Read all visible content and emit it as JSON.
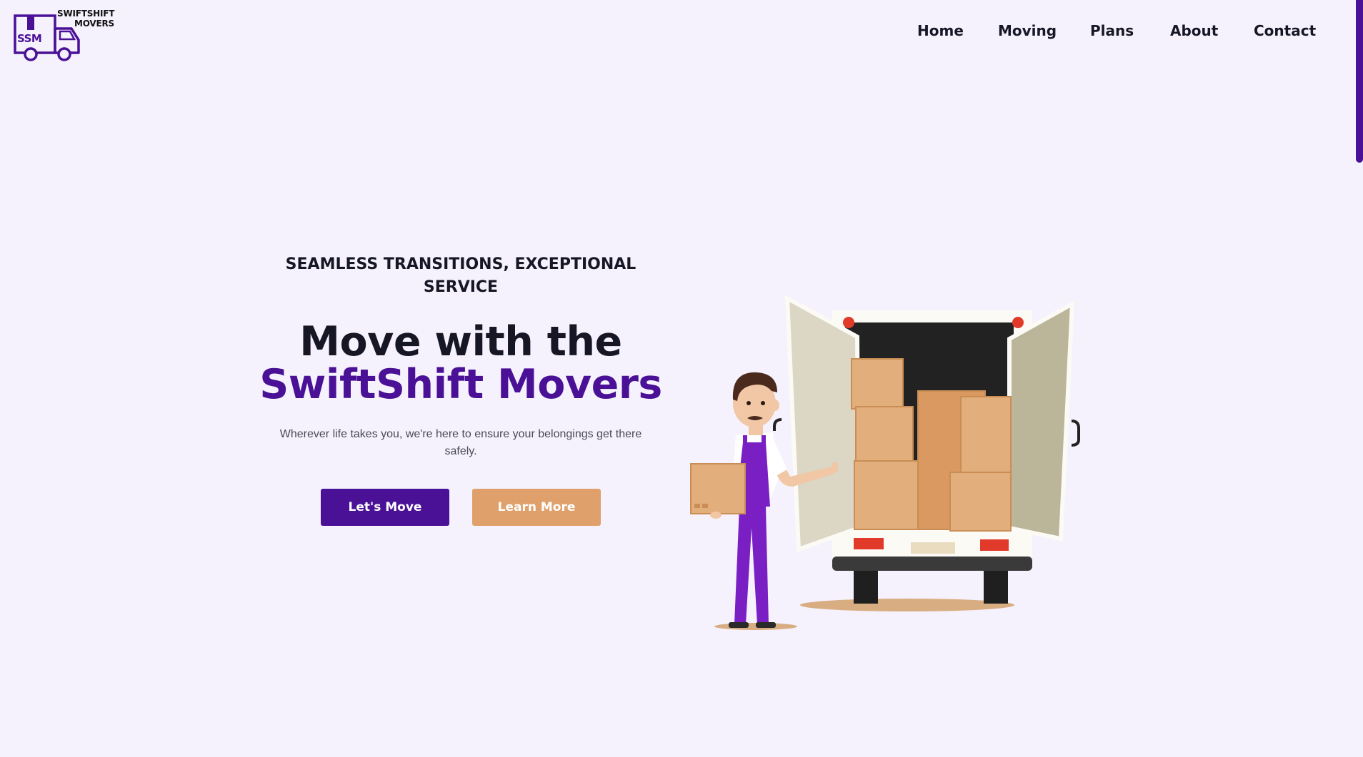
{
  "brand": {
    "logo_initials": "SSM",
    "logo_line1": "SWIFTSHIFT",
    "logo_line2": "MOVERS",
    "primary_color": "#4a1196",
    "accent_color": "#e0a06b",
    "background_color": "#f5f2fd"
  },
  "nav": {
    "items": [
      {
        "label": "Home"
      },
      {
        "label": "Moving"
      },
      {
        "label": "Plans"
      },
      {
        "label": "About"
      },
      {
        "label": "Contact"
      }
    ]
  },
  "hero": {
    "tagline": "SEAMLESS TRANSITIONS, EXCEPTIONAL SERVICE",
    "headline_line1": "Move with the",
    "headline_line2": "SwiftShift Movers",
    "subtext": "Wherever life takes you, we're here to ensure your belongings get there safely.",
    "primary_button": "Let's Move",
    "secondary_button": "Learn More"
  },
  "illustration": {
    "icon": "mover-with-truck-illustration"
  }
}
